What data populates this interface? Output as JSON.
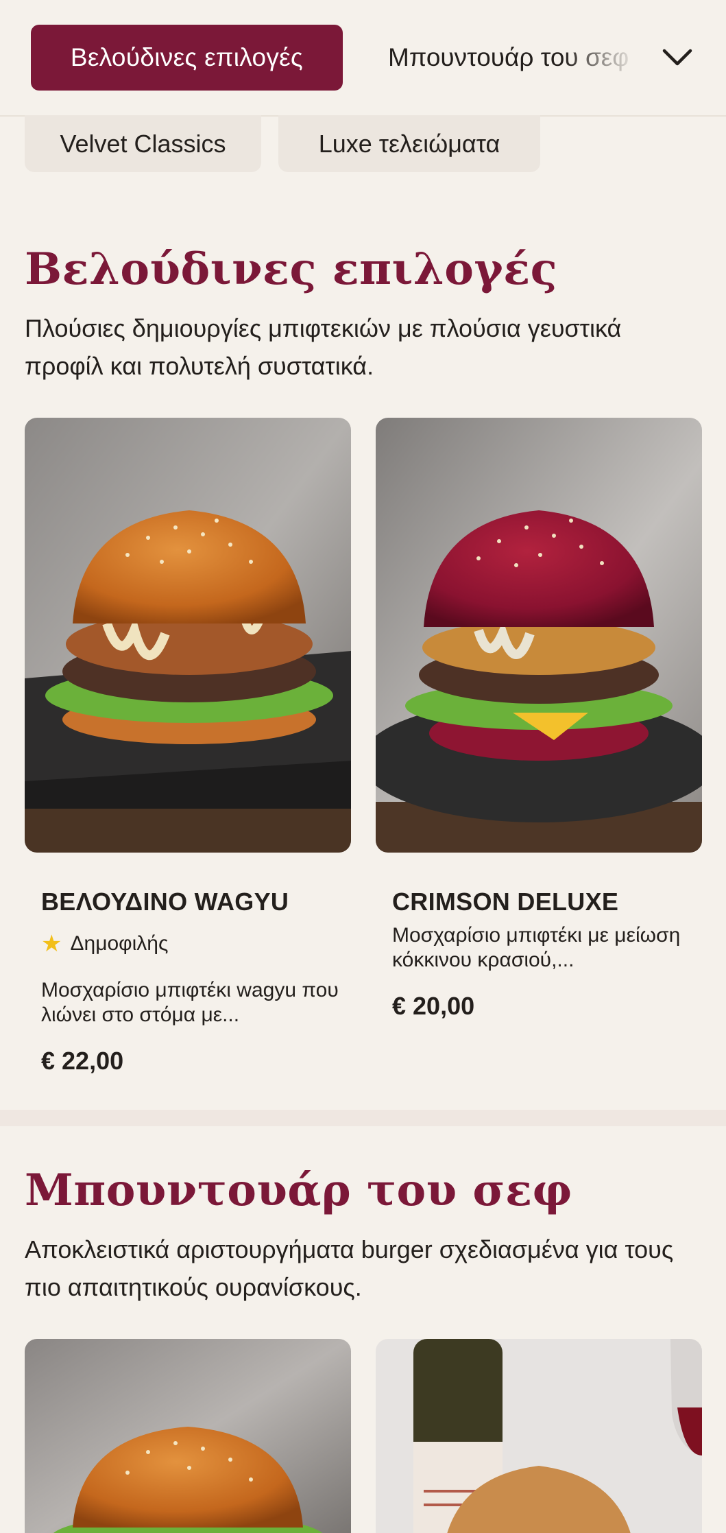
{
  "nav": {
    "active_tab": "Βελούδινες επιλογές",
    "next_tab": "Μπουντουάρ του σεφ",
    "chips": [
      "Velvet Classics",
      "Luxe τελειώματα"
    ]
  },
  "sections": [
    {
      "title": "Βελούδινες επιλογές",
      "description": "Πλούσιες δημιουργίες μπιφτεκιών με πλούσια γευστικά προφίλ και πολυτελή συστατικά.",
      "products": [
        {
          "name": "ΒΕΛΟΥΔΙΝΟ WAGYU",
          "badge": "Δημοφιλής",
          "description": "Μοσχαρίσιο μπιφτέκι wagyu που λιώνει στο στόμα με...",
          "price": "€ 22,00"
        },
        {
          "name": "CRIMSON DELUXE",
          "description": "Μοσχαρίσιο μπιφτέκι με μείωση κόκκινου κρασιού,...",
          "price": "€ 20,00"
        }
      ]
    },
    {
      "title": "Μπουντουάρ του σεφ",
      "description": "Αποκλειστικά αριστουργήματα burger σχεδιασμένα για τους πιο απαιτητικούς ουρανίσκους."
    }
  ],
  "icons": {
    "expand": "chevron-down-icon",
    "badge": "star-icon"
  },
  "colors": {
    "accent": "#7b1838",
    "background": "#f5f1eb",
    "star": "#f2bf1a"
  }
}
